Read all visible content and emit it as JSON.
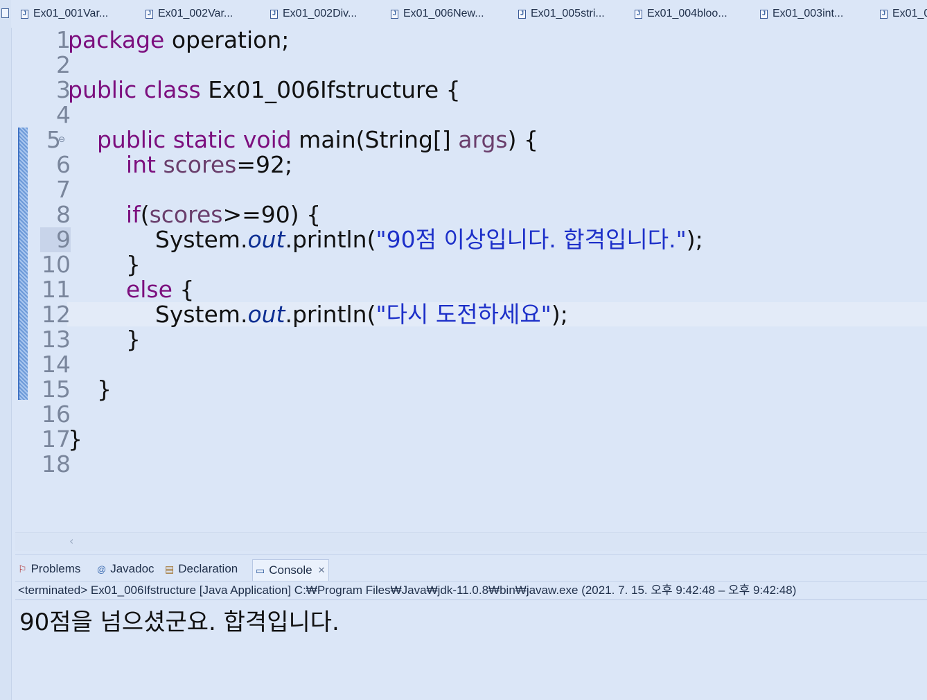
{
  "tabs": [
    {
      "label": "Ex01_001Var..."
    },
    {
      "label": "Ex01_002Var..."
    },
    {
      "label": "Ex01_002Div..."
    },
    {
      "label": "Ex01_006New..."
    },
    {
      "label": "Ex01_005stri..."
    },
    {
      "label": "Ex01_004bloo..."
    },
    {
      "label": "Ex01_003int..."
    },
    {
      "label": "Ex01_0"
    }
  ],
  "editor": {
    "current_line": 12,
    "line_numbers": [
      "1",
      "2",
      "3",
      "4",
      "5",
      "6",
      "7",
      "8",
      "9",
      "10",
      "11",
      "12",
      "13",
      "14",
      "15",
      "16",
      "17",
      "18"
    ],
    "code": {
      "l1_kw": "package",
      "l1_rest": " operation;",
      "l3_kw": "public class",
      "l3_rest": " Ex01_006Ifstructure {",
      "l5_indent": "    ",
      "l5_kw": "public static void",
      "l5_mid": " main(String[] ",
      "l5_args": "args",
      "l5_end": ") {",
      "l6_indent": "        ",
      "l6_kw": "int",
      "l6_sp": " ",
      "l6_var": "scores",
      "l6_end": "=92;",
      "l8_indent": "        ",
      "l8_kw": "if",
      "l8_open": "(",
      "l8_var": "scores",
      "l8_end": ">=90) {",
      "l9_indent": "            ",
      "l9_sys": "System.",
      "l9_out": "out",
      "l9_println": ".println(",
      "l9_str": "\"90점 이상입니다. 합격입니다.\"",
      "l9_end": ");",
      "l10": "        }",
      "l11_indent": "        ",
      "l11_kw": "else",
      "l11_end": " {",
      "l12_indent": "            ",
      "l12_sys": "System.",
      "l12_out": "out",
      "l12_println": ".println(",
      "l12_str": "\"다시 도전하세요\"",
      "l12_end": ");",
      "l13": "        }",
      "l15": "    }",
      "l17": "}"
    }
  },
  "panel": {
    "tabs": [
      {
        "label": "Problems"
      },
      {
        "label": "Javadoc"
      },
      {
        "label": "Declaration"
      },
      {
        "label": "Console"
      }
    ],
    "console_close": "✕",
    "console_header": "<terminated> Ex01_006Ifstructure [Java Application] C:₩Program Files₩Java₩jdk-11.0.8₩bin₩javaw.exe  (2021. 7. 15. 오후 9:42:48 – 오후 9:42:48)",
    "console_output": "90점을 넘으셨군요. 합격입니다."
  },
  "colors": {
    "keyword": "#7c0f7e",
    "field": "#0c2e92",
    "string": "#1d30c9",
    "background": "#dbe6f7"
  }
}
